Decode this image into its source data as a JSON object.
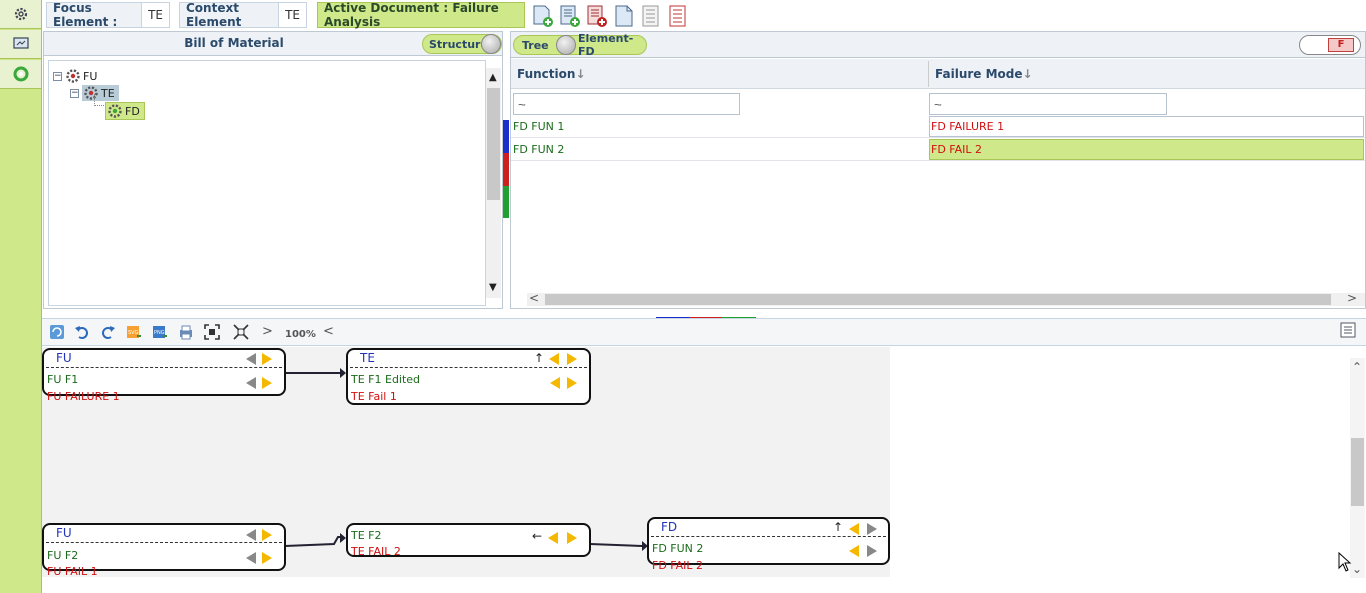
{
  "toolbar": {
    "focus_label": "Focus Element :",
    "focus_value": "TE",
    "context_label": "Context Element",
    "context_value": "TE",
    "active_doc": "Active Document : Failure Analysis"
  },
  "bom": {
    "title": "Bill of Material",
    "toggle": "Structure",
    "tree": [
      "FU",
      "TE",
      "FD"
    ]
  },
  "fa": {
    "toggle_left": "Tree",
    "toggle_right": "Element-FD",
    "badge": "F",
    "col_function": "Function",
    "col_failure": "Failure Mode",
    "filter_function": "~",
    "filter_failure": "~",
    "rows": [
      {
        "function": "FD FUN 1",
        "failure": "FD FAILURE 1"
      },
      {
        "function": "FD FUN 2",
        "failure": "FD FAIL 2"
      }
    ]
  },
  "diagram": {
    "zoom": "100%",
    "nodes": {
      "fu1": {
        "title": "FU",
        "func": "FU F1",
        "fail": "FU FAILURE 1"
      },
      "te1": {
        "title": "TE",
        "func": "TE F1 Edited",
        "fail": "TE Fail 1"
      },
      "fu2": {
        "title": "FU",
        "func": "FU F2",
        "fail": "FU FAIL 1"
      },
      "te2": {
        "func": "TE F2",
        "fail": "TE FAIL 2"
      },
      "fd": {
        "title": "FD",
        "func": "FD FUN 2",
        "fail": "FD FAIL 2"
      }
    }
  },
  "colors": {
    "accent": "#cfe88a",
    "header": "#2b4a6b",
    "function_text": "#1a6b1a",
    "failure_text": "#d01010",
    "selected_row": "#cfe88a"
  }
}
